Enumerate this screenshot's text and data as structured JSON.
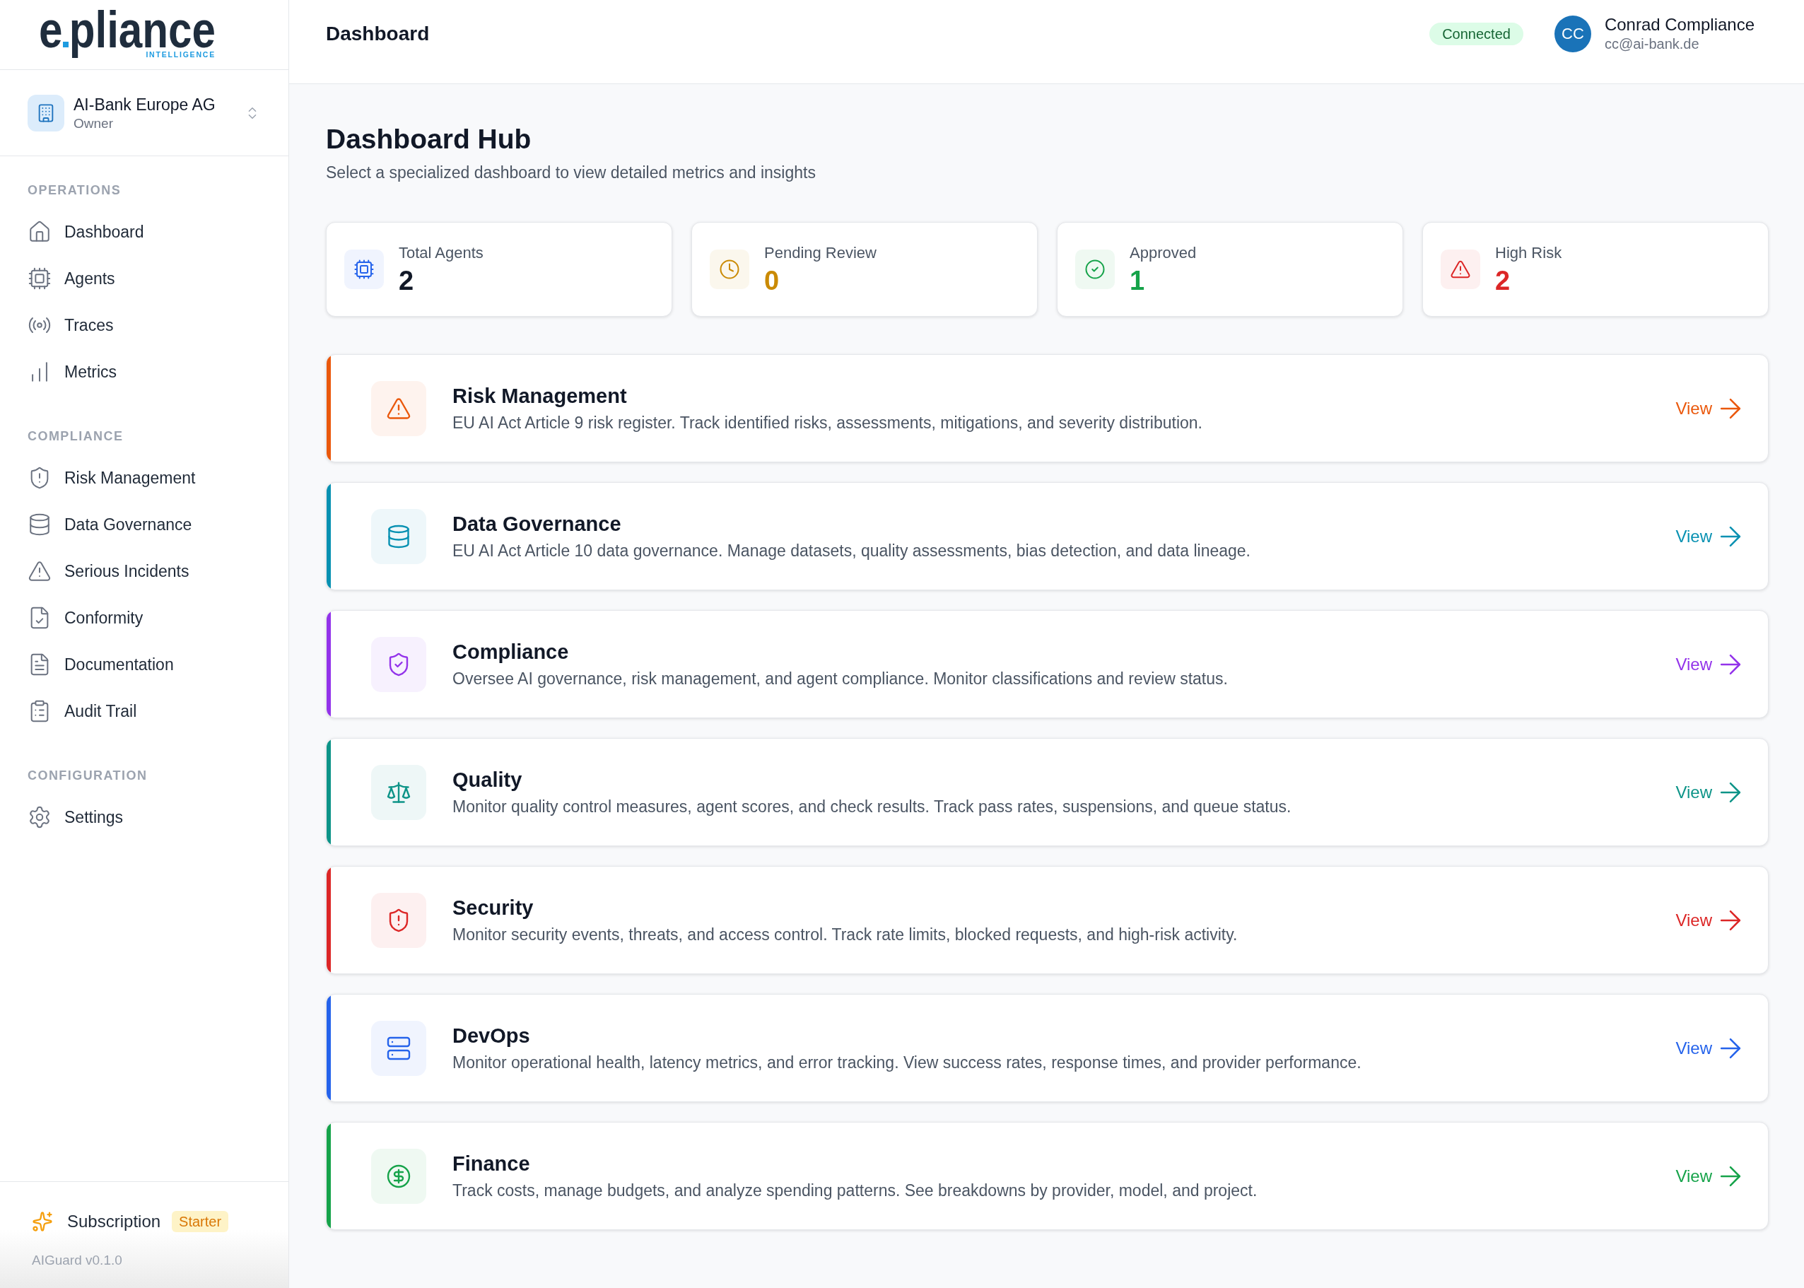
{
  "sidebar": {
    "brand": {
      "wordmark": "epliance",
      "tagline": "INTELLIGENCE"
    },
    "organization": {
      "name": "AI-Bank Europe AG",
      "role": "Owner"
    },
    "sections": [
      {
        "heading": "OPERATIONS",
        "items": [
          {
            "label": "Dashboard"
          },
          {
            "label": "Agents"
          },
          {
            "label": "Traces"
          },
          {
            "label": "Metrics"
          }
        ]
      },
      {
        "heading": "COMPLIANCE",
        "items": [
          {
            "label": "Risk Management"
          },
          {
            "label": "Data Governance"
          },
          {
            "label": "Serious Incidents"
          },
          {
            "label": "Conformity"
          },
          {
            "label": "Documentation"
          },
          {
            "label": "Audit Trail"
          }
        ]
      },
      {
        "heading": "CONFIGURATION",
        "items": [
          {
            "label": "Settings"
          }
        ]
      }
    ],
    "subscription": {
      "label": "Subscription",
      "plan": "Starter"
    },
    "version": "AIGuard v0.1.0"
  },
  "header": {
    "title": "Dashboard",
    "status": "Connected",
    "user": {
      "initials": "CC",
      "name": "Conrad Compliance",
      "email": "cc@ai-bank.de"
    }
  },
  "page": {
    "title": "Dashboard Hub",
    "subtitle": "Select a specialized dashboard to view detailed metrics and insights"
  },
  "stats": [
    {
      "label": "Total Agents",
      "color": "#2563eb",
      "value": {
        "text": "2",
        "color": "#111827"
      }
    },
    {
      "label": "Pending Review",
      "color": "#ca8a04",
      "value": {
        "text": "0",
        "color": "#ca8a04"
      }
    },
    {
      "label": "Approved",
      "color": "#16a34a",
      "value": {
        "text": "1",
        "color": "#16a34a"
      }
    },
    {
      "label": "High Risk",
      "color": "#dc2626",
      "value": {
        "text": "2",
        "color": "#dc2626"
      }
    }
  ],
  "modules": [
    {
      "title": "Risk Management",
      "description": "EU AI Act Article 9 risk register. Track identified risks, assessments, mitigations, and severity distribution.",
      "action": "View",
      "color": "#ea580c"
    },
    {
      "title": "Data Governance",
      "description": "EU AI Act Article 10 data governance. Manage datasets, quality assessments, bias detection, and data lineage.",
      "action": "View",
      "color": "#0891b2"
    },
    {
      "title": "Compliance",
      "description": "Oversee AI governance, risk management, and agent compliance. Monitor classifications and review status.",
      "action": "View",
      "color": "#9333ea"
    },
    {
      "title": "Quality",
      "description": "Monitor quality control measures, agent scores, and check results. Track pass rates, suspensions, and queue status.",
      "action": "View",
      "color": "#0d9488"
    },
    {
      "title": "Security",
      "description": "Monitor security events, threats, and access control. Track rate limits, blocked requests, and high-risk activity.",
      "action": "View",
      "color": "#dc2626"
    },
    {
      "title": "DevOps",
      "description": "Monitor operational health, latency metrics, and error tracking. View success rates, response times, and provider performance.",
      "action": "View",
      "color": "#2563eb"
    },
    {
      "title": "Finance",
      "description": "Track costs, manage budgets, and analyze spending patterns. See breakdowns by provider, model, and project.",
      "action": "View",
      "color": "#16a34a"
    }
  ]
}
